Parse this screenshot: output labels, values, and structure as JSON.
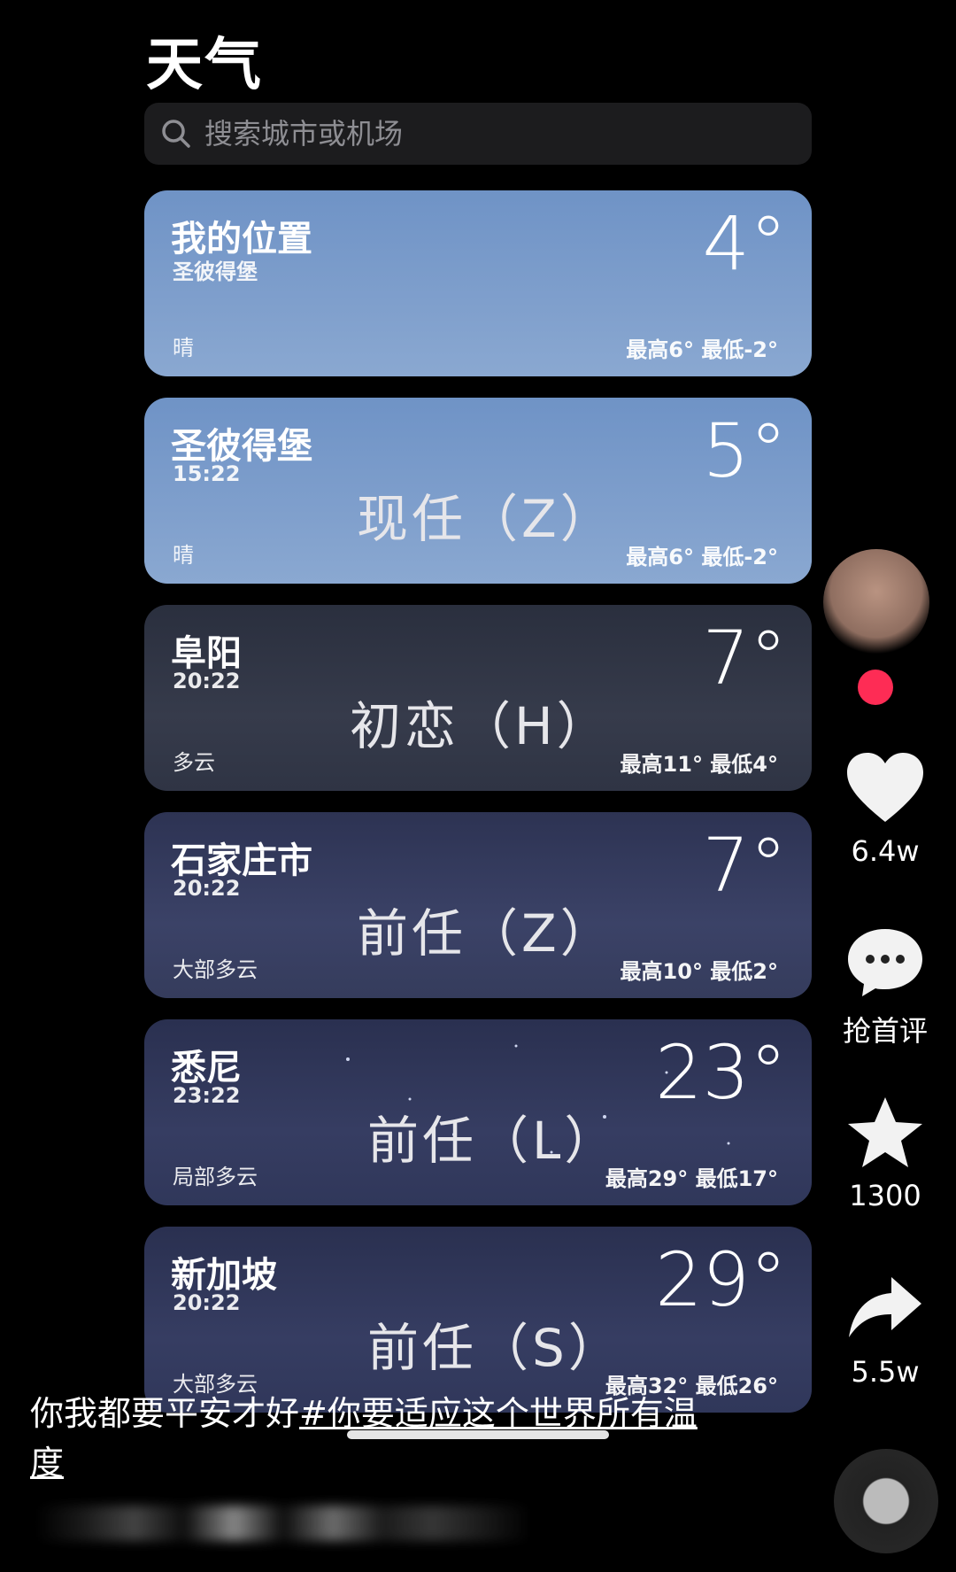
{
  "app_title": "天气",
  "search": {
    "placeholder": "搜索城市或机场"
  },
  "cards": [
    {
      "name": "我的位置",
      "sub": "圣彼得堡",
      "cond": "晴",
      "temp": "4°",
      "hilo": "最高6°  最低-2°",
      "overlay": ""
    },
    {
      "name": "圣彼得堡",
      "sub": "15:22",
      "cond": "晴",
      "temp": "5°",
      "hilo": "最高6°  最低-2°",
      "overlay": "现任（Z）"
    },
    {
      "name": "阜阳",
      "sub": "20:22",
      "cond": "多云",
      "temp": "7°",
      "hilo": "最高11°  最低4°",
      "overlay": "初恋（H）"
    },
    {
      "name": "石家庄市",
      "sub": "20:22",
      "cond": "大部多云",
      "temp": "7°",
      "hilo": "最高10°  最低2°",
      "overlay": "前任（Z）"
    },
    {
      "name": "悉尼",
      "sub": "23:22",
      "cond": "局部多云",
      "temp": "23°",
      "hilo": "最高29°  最低17°",
      "overlay": "前任（L）"
    },
    {
      "name": "新加坡",
      "sub": "20:22",
      "cond": "大部多云",
      "temp": "29°",
      "hilo": "最高32°  最低26°",
      "overlay": "前任（S）"
    }
  ],
  "actions": {
    "likes": "6.4w",
    "comments": "抢首评",
    "favorites": "1300",
    "shares": "5.5w"
  },
  "caption": {
    "text": "你我都要平安才好",
    "hashtag": "#你要适应这个世界所有温度"
  },
  "colors": {
    "accent": "#fe2c55",
    "background": "#000000"
  }
}
